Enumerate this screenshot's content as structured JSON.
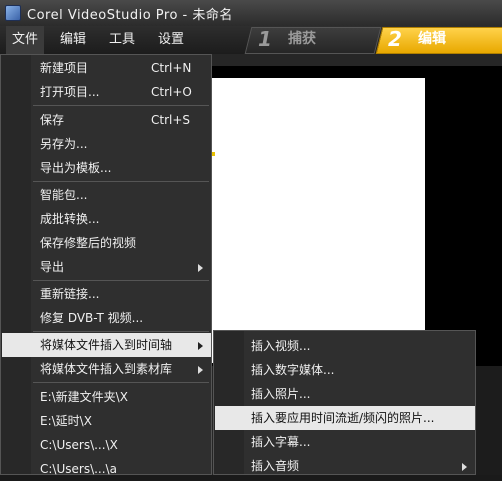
{
  "window": {
    "title": "Corel VideoStudio Pro - 未命名",
    "icon": "app-icon"
  },
  "menubar": {
    "file": "文件",
    "edit": "编辑",
    "tools": "工具",
    "settings": "设置"
  },
  "steps": {
    "capture": {
      "num": "1",
      "label": "捕获"
    },
    "edit": {
      "num": "2",
      "label": "编辑"
    }
  },
  "colors": {
    "accent": "#f0b400",
    "highlight": "#e8e8e8",
    "menu_bg": "#2f2f2f"
  },
  "file_menu": {
    "new_project": "新建项目",
    "new_project_shortcut": "Ctrl+N",
    "open_project": "打开项目...",
    "open_project_shortcut": "Ctrl+O",
    "save": "保存",
    "save_shortcut": "Ctrl+S",
    "save_as": "另存为...",
    "export_template": "导出为模板...",
    "smart_package": "智能包...",
    "batch_convert": "成批转换...",
    "save_trimmed": "保存修整后的视频",
    "export": "导出",
    "relink": "重新链接...",
    "repair_dvbt": "修复 DVB-T 视频...",
    "insert_timeline": "将媒体文件插入到时间轴",
    "insert_library": "将媒体文件插入到素材库",
    "recent_1": "E:\\新建文件夹\\X",
    "recent_2": "E:\\延时\\X",
    "recent_3": "C:\\Users\\...\\X",
    "recent_4": "C:\\Users\\...\\a"
  },
  "submenu": {
    "insert_video": "插入视频...",
    "insert_digital_media": "插入数字媒体...",
    "insert_photo": "插入照片...",
    "insert_timelapse_photo": "插入要应用时间流逝/频闪的照片...",
    "insert_subtitle": "插入字幕...",
    "insert_audio": "插入音频"
  }
}
